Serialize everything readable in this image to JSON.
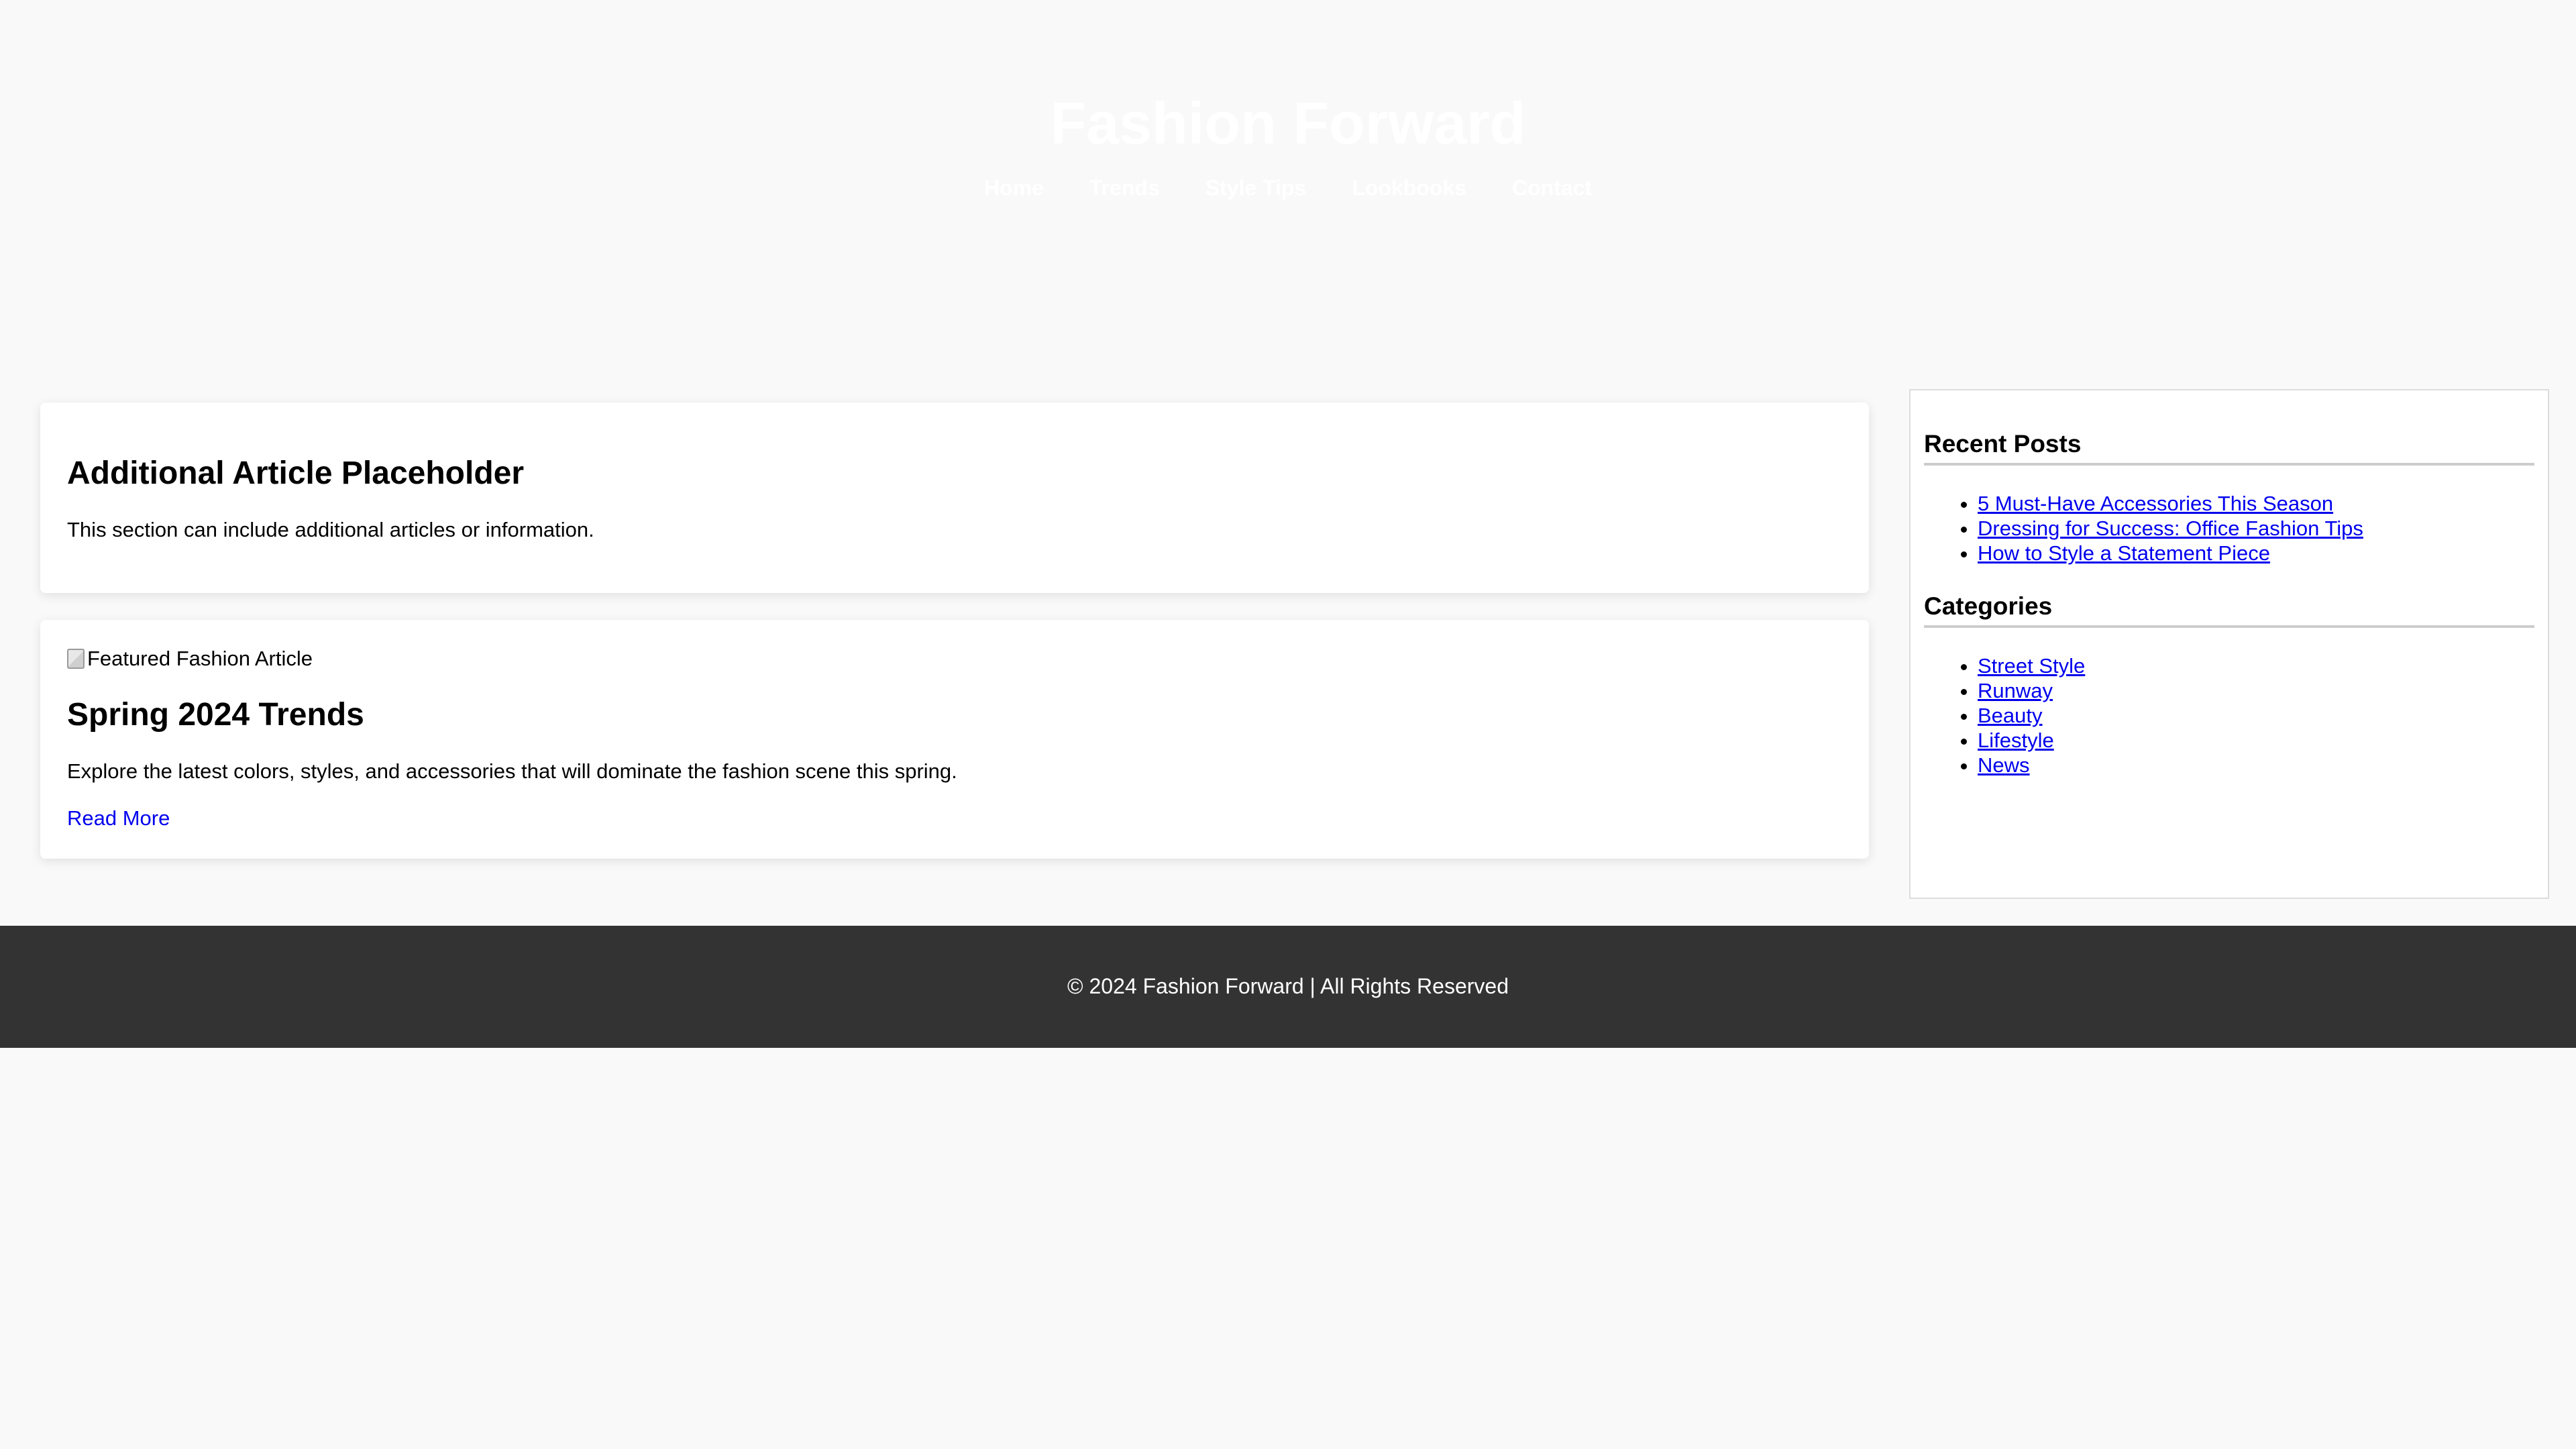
{
  "header": {
    "title": "Fashion Forward",
    "nav": [
      {
        "label": "Home"
      },
      {
        "label": "Trends"
      },
      {
        "label": "Style Tips"
      },
      {
        "label": "Lookbooks"
      },
      {
        "label": "Contact"
      }
    ]
  },
  "articles": [
    {
      "title": "Additional Article Placeholder",
      "text": "This section can include additional articles or information."
    },
    {
      "image_alt": "Featured Fashion Article",
      "title": "Spring 2024 Trends",
      "text": "Explore the latest colors, styles, and accessories that will dominate the fashion scene this spring.",
      "link_label": "Read More"
    }
  ],
  "sidebar": {
    "recent_heading": "Recent Posts",
    "recent_posts": [
      "5 Must-Have Accessories This Season",
      "Dressing for Success: Office Fashion Tips",
      "How to Style a Statement Piece"
    ],
    "categories_heading": "Categories",
    "categories": [
      "Street Style",
      "Runway",
      "Beauty",
      "Lifestyle",
      "News"
    ]
  },
  "footer": {
    "text": "© 2024 Fashion Forward | All Rights Reserved"
  },
  "colors": {
    "page_background": "#f9f9f9",
    "header_text": "#ffffff",
    "link": "#0000ee",
    "footer_background": "#333333"
  },
  "icons": {
    "broken_image": "broken-image-icon"
  }
}
